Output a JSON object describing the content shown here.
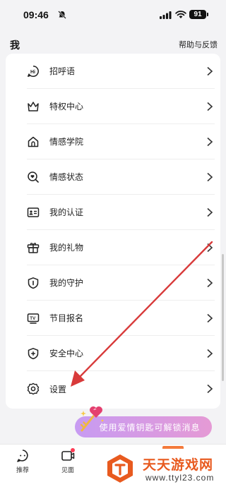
{
  "status_bar": {
    "time": "09:46",
    "battery": "91"
  },
  "header": {
    "title": "我",
    "help": "帮助与反馈"
  },
  "menu": [
    {
      "label": "招呼语",
      "icon": "hi-icon"
    },
    {
      "label": "特权中心",
      "icon": "crown-icon"
    },
    {
      "label": "情感学院",
      "icon": "house-icon"
    },
    {
      "label": "情感状态",
      "icon": "search-heart-icon"
    },
    {
      "label": "我的认证",
      "icon": "id-card-icon"
    },
    {
      "label": "我的礼物",
      "icon": "gift-icon"
    },
    {
      "label": "我的守护",
      "icon": "shield-icon"
    },
    {
      "label": "节目报名",
      "icon": "tv-icon"
    },
    {
      "label": "安全中心",
      "icon": "shield-plus-icon"
    },
    {
      "label": "设置",
      "icon": "gear-icon"
    }
  ],
  "promo": {
    "text": "使用爱情钥匙可解锁消息"
  },
  "tabbar": {
    "tab1": "推荐",
    "tab2": "见面"
  },
  "watermark": {
    "title": "天天游戏网",
    "url": "www.ttyl23.com"
  },
  "colors": {
    "arrow": "#d83a3a",
    "promo_start": "#c79bf2",
    "promo_end": "#e59ad5",
    "watermark": "#e85a1f"
  }
}
